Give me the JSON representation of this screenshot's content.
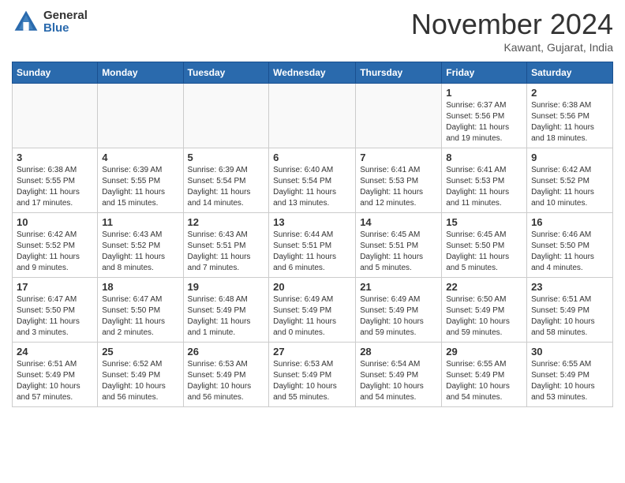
{
  "header": {
    "logo_general": "General",
    "logo_blue": "Blue",
    "month_title": "November 2024",
    "location": "Kawant, Gujarat, India"
  },
  "days_of_week": [
    "Sunday",
    "Monday",
    "Tuesday",
    "Wednesday",
    "Thursday",
    "Friday",
    "Saturday"
  ],
  "weeks": [
    [
      {
        "day": "",
        "detail": ""
      },
      {
        "day": "",
        "detail": ""
      },
      {
        "day": "",
        "detail": ""
      },
      {
        "day": "",
        "detail": ""
      },
      {
        "day": "",
        "detail": ""
      },
      {
        "day": "1",
        "detail": "Sunrise: 6:37 AM\nSunset: 5:56 PM\nDaylight: 11 hours and 19 minutes."
      },
      {
        "day": "2",
        "detail": "Sunrise: 6:38 AM\nSunset: 5:56 PM\nDaylight: 11 hours and 18 minutes."
      }
    ],
    [
      {
        "day": "3",
        "detail": "Sunrise: 6:38 AM\nSunset: 5:55 PM\nDaylight: 11 hours and 17 minutes."
      },
      {
        "day": "4",
        "detail": "Sunrise: 6:39 AM\nSunset: 5:55 PM\nDaylight: 11 hours and 15 minutes."
      },
      {
        "day": "5",
        "detail": "Sunrise: 6:39 AM\nSunset: 5:54 PM\nDaylight: 11 hours and 14 minutes."
      },
      {
        "day": "6",
        "detail": "Sunrise: 6:40 AM\nSunset: 5:54 PM\nDaylight: 11 hours and 13 minutes."
      },
      {
        "day": "7",
        "detail": "Sunrise: 6:41 AM\nSunset: 5:53 PM\nDaylight: 11 hours and 12 minutes."
      },
      {
        "day": "8",
        "detail": "Sunrise: 6:41 AM\nSunset: 5:53 PM\nDaylight: 11 hours and 11 minutes."
      },
      {
        "day": "9",
        "detail": "Sunrise: 6:42 AM\nSunset: 5:52 PM\nDaylight: 11 hours and 10 minutes."
      }
    ],
    [
      {
        "day": "10",
        "detail": "Sunrise: 6:42 AM\nSunset: 5:52 PM\nDaylight: 11 hours and 9 minutes."
      },
      {
        "day": "11",
        "detail": "Sunrise: 6:43 AM\nSunset: 5:52 PM\nDaylight: 11 hours and 8 minutes."
      },
      {
        "day": "12",
        "detail": "Sunrise: 6:43 AM\nSunset: 5:51 PM\nDaylight: 11 hours and 7 minutes."
      },
      {
        "day": "13",
        "detail": "Sunrise: 6:44 AM\nSunset: 5:51 PM\nDaylight: 11 hours and 6 minutes."
      },
      {
        "day": "14",
        "detail": "Sunrise: 6:45 AM\nSunset: 5:51 PM\nDaylight: 11 hours and 5 minutes."
      },
      {
        "day": "15",
        "detail": "Sunrise: 6:45 AM\nSunset: 5:50 PM\nDaylight: 11 hours and 5 minutes."
      },
      {
        "day": "16",
        "detail": "Sunrise: 6:46 AM\nSunset: 5:50 PM\nDaylight: 11 hours and 4 minutes."
      }
    ],
    [
      {
        "day": "17",
        "detail": "Sunrise: 6:47 AM\nSunset: 5:50 PM\nDaylight: 11 hours and 3 minutes."
      },
      {
        "day": "18",
        "detail": "Sunrise: 6:47 AM\nSunset: 5:50 PM\nDaylight: 11 hours and 2 minutes."
      },
      {
        "day": "19",
        "detail": "Sunrise: 6:48 AM\nSunset: 5:49 PM\nDaylight: 11 hours and 1 minute."
      },
      {
        "day": "20",
        "detail": "Sunrise: 6:49 AM\nSunset: 5:49 PM\nDaylight: 11 hours and 0 minutes."
      },
      {
        "day": "21",
        "detail": "Sunrise: 6:49 AM\nSunset: 5:49 PM\nDaylight: 10 hours and 59 minutes."
      },
      {
        "day": "22",
        "detail": "Sunrise: 6:50 AM\nSunset: 5:49 PM\nDaylight: 10 hours and 59 minutes."
      },
      {
        "day": "23",
        "detail": "Sunrise: 6:51 AM\nSunset: 5:49 PM\nDaylight: 10 hours and 58 minutes."
      }
    ],
    [
      {
        "day": "24",
        "detail": "Sunrise: 6:51 AM\nSunset: 5:49 PM\nDaylight: 10 hours and 57 minutes."
      },
      {
        "day": "25",
        "detail": "Sunrise: 6:52 AM\nSunset: 5:49 PM\nDaylight: 10 hours and 56 minutes."
      },
      {
        "day": "26",
        "detail": "Sunrise: 6:53 AM\nSunset: 5:49 PM\nDaylight: 10 hours and 56 minutes."
      },
      {
        "day": "27",
        "detail": "Sunrise: 6:53 AM\nSunset: 5:49 PM\nDaylight: 10 hours and 55 minutes."
      },
      {
        "day": "28",
        "detail": "Sunrise: 6:54 AM\nSunset: 5:49 PM\nDaylight: 10 hours and 54 minutes."
      },
      {
        "day": "29",
        "detail": "Sunrise: 6:55 AM\nSunset: 5:49 PM\nDaylight: 10 hours and 54 minutes."
      },
      {
        "day": "30",
        "detail": "Sunrise: 6:55 AM\nSunset: 5:49 PM\nDaylight: 10 hours and 53 minutes."
      }
    ]
  ]
}
